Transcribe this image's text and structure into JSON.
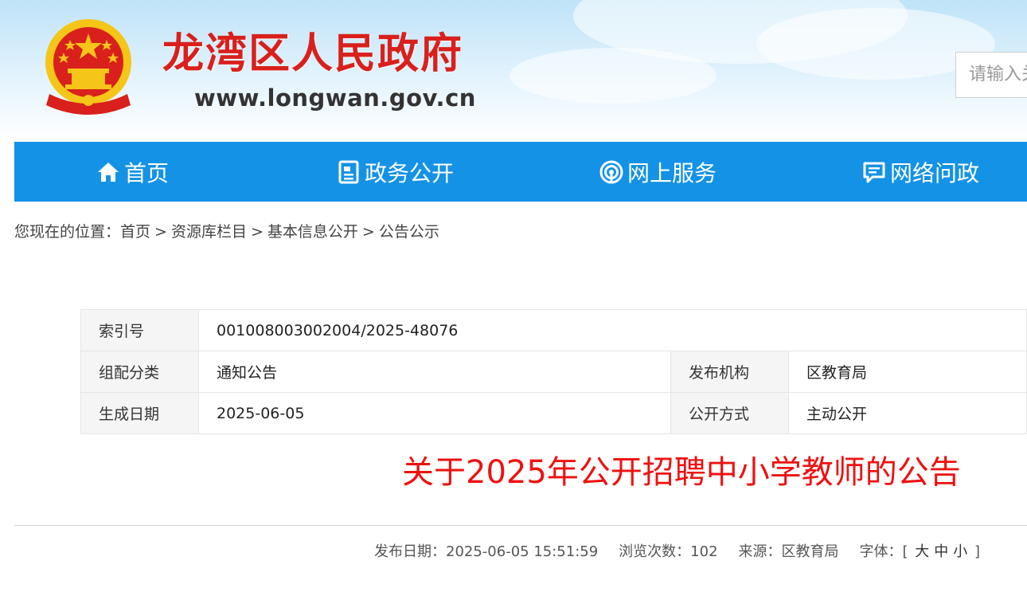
{
  "header": {
    "site_title": "龙湾区人民政府",
    "site_url": "www.longwan.gov.cn",
    "search_placeholder": "请输入关键词",
    "emblem_colors": {
      "red": "#d9201c",
      "gold": "#f5c518"
    }
  },
  "nav": {
    "color": "#1492e6",
    "items": [
      {
        "label": "首页",
        "icon": "home-icon"
      },
      {
        "label": "政务公开",
        "icon": "document-icon"
      },
      {
        "label": "网上服务",
        "icon": "broadcast-icon"
      },
      {
        "label": "网络问政",
        "icon": "chat-icon"
      }
    ]
  },
  "breadcrumb": {
    "prefix": "您现在的位置：",
    "items": [
      "首页",
      "资源库栏目",
      "基本信息公开",
      "公告公示"
    ],
    "separator": ">"
  },
  "meta": {
    "index_label": "索引号",
    "index_value": "001008003002004/2025-48076",
    "category_label": "组配分类",
    "category_value": "通知公告",
    "publisher_label": "发布机构",
    "publisher_value": "区教育局",
    "date_label": "生成日期",
    "date_value": "2025-06-05",
    "method_label": "公开方式",
    "method_value": "主动公开"
  },
  "article": {
    "title": "关于2025年公开招聘中小学教师的公告",
    "title_color": "#ee1111",
    "publish_label": "发布日期：",
    "publish_value": "2025-06-05 15:51:59",
    "views_label": "浏览次数：",
    "views_value": "102",
    "source_label": "来源：",
    "source_value": "区教育局",
    "font_label": "字体：",
    "font_open": "[",
    "font_large": "大",
    "font_medium": "中",
    "font_small": "小",
    "font_close": "]"
  }
}
